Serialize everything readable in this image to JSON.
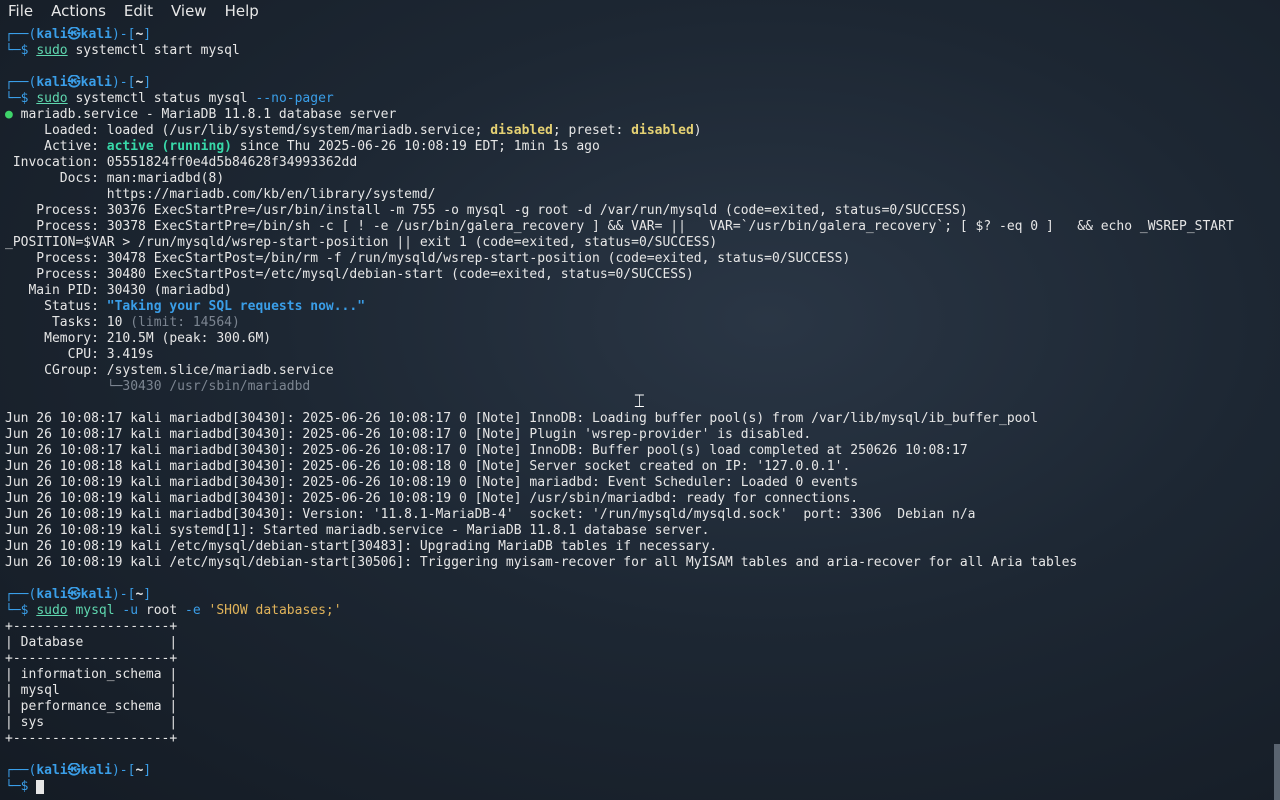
{
  "menu": [
    "File",
    "Actions",
    "Edit",
    "View",
    "Help"
  ],
  "prompt": {
    "top_left": "┌──(",
    "user": "kali",
    "at": "㉿",
    "host": "kali",
    "mid": ")-[",
    "dir": "~",
    "close": "]",
    "bottom": "└─$ "
  },
  "commands": {
    "c1": {
      "sudo": "sudo",
      "rest": " systemctl start mysql"
    },
    "c2": {
      "sudo": "sudo",
      "rest": " systemctl status mysql ",
      "flag": "--no-pager"
    },
    "c3": {
      "sudo": "sudo",
      "cmd": " mysql ",
      "flag1": "-u",
      "mid": " root ",
      "flag2": "-e",
      "sp": " ",
      "str": "'SHOW databases;'"
    }
  },
  "status": {
    "dot": "●",
    "head": " mariadb.service - MariaDB 11.8.1 database server",
    "loaded_a": "     Loaded: loaded (/usr/lib/systemd/system/mariadb.service; ",
    "loaded_dis1": "disabled",
    "loaded_b": "; preset: ",
    "loaded_dis2": "disabled",
    "loaded_c": ")",
    "active_a": "     Active: ",
    "active_state": "active (running)",
    "active_b": " since Thu 2025-06-26 10:08:19 EDT; 1min 1s ago",
    "invocation": " Invocation: 05551824ff0e4d5b84628f34993362dd",
    "docs1": "       Docs: man:mariadbd(8)",
    "docs2": "             https://mariadb.com/kb/en/library/systemd/",
    "proc1": "    Process: 30376 ExecStartPre=/usr/bin/install -m 755 -o mysql -g root -d /var/run/mysqld (code=exited, status=0/SUCCESS)",
    "proc2": "    Process: 30378 ExecStartPre=/bin/sh -c [ ! -e /usr/bin/galera_recovery ] && VAR= ||   VAR=`/usr/bin/galera_recovery`; [ $? -eq 0 ]   && echo _WSREP_START",
    "proc2b": "_POSITION=$VAR > /run/mysqld/wsrep-start-position || exit 1 (code=exited, status=0/SUCCESS)",
    "proc3": "    Process: 30478 ExecStartPost=/bin/rm -f /run/mysqld/wsrep-start-position (code=exited, status=0/SUCCESS)",
    "proc4": "    Process: 30480 ExecStartPost=/etc/mysql/debian-start (code=exited, status=0/SUCCESS)",
    "mainpid": "   Main PID: 30430 (mariadbd)",
    "status_a": "     Status: ",
    "status_q": "\"Taking your SQL requests now...\"",
    "tasks_a": "      Tasks: 10 ",
    "tasks_limit": "(limit: 14564)",
    "memory": "     Memory: 210.5M (peak: 300.6M)",
    "cpu": "        CPU: 3.419s",
    "cgroup": "     CGroup: /system.slice/mariadb.service",
    "cgroup_tree": "             └─30430 /usr/sbin/mariadbd"
  },
  "logs": [
    "Jun 26 10:08:17 kali mariadbd[30430]: 2025-06-26 10:08:17 0 [Note] InnoDB: Loading buffer pool(s) from /var/lib/mysql/ib_buffer_pool",
    "Jun 26 10:08:17 kali mariadbd[30430]: 2025-06-26 10:08:17 0 [Note] Plugin 'wsrep-provider' is disabled.",
    "Jun 26 10:08:17 kali mariadbd[30430]: 2025-06-26 10:08:17 0 [Note] InnoDB: Buffer pool(s) load completed at 250626 10:08:17",
    "Jun 26 10:08:18 kali mariadbd[30430]: 2025-06-26 10:08:18 0 [Note] Server socket created on IP: '127.0.0.1'.",
    "Jun 26 10:08:19 kali mariadbd[30430]: 2025-06-26 10:08:19 0 [Note] mariadbd: Event Scheduler: Loaded 0 events",
    "Jun 26 10:08:19 kali mariadbd[30430]: 2025-06-26 10:08:19 0 [Note] /usr/sbin/mariadbd: ready for connections.",
    "Jun 26 10:08:19 kali mariadbd[30430]: Version: '11.8.1-MariaDB-4'  socket: '/run/mysqld/mysqld.sock'  port: 3306  Debian n/a",
    "Jun 26 10:08:19 kali systemd[1]: Started mariadb.service - MariaDB 11.8.1 database server.",
    "Jun 26 10:08:19 kali /etc/mysql/debian-start[30483]: Upgrading MariaDB tables if necessary.",
    "Jun 26 10:08:19 kali /etc/mysql/debian-start[30506]: Triggering myisam-recover for all MyISAM tables and aria-recover for all Aria tables"
  ],
  "table": {
    "border": "+--------------------+",
    "header": "| Database           |",
    "rows": [
      "| information_schema |",
      "| mysql              |",
      "| performance_schema |",
      "| sys                |"
    ]
  }
}
